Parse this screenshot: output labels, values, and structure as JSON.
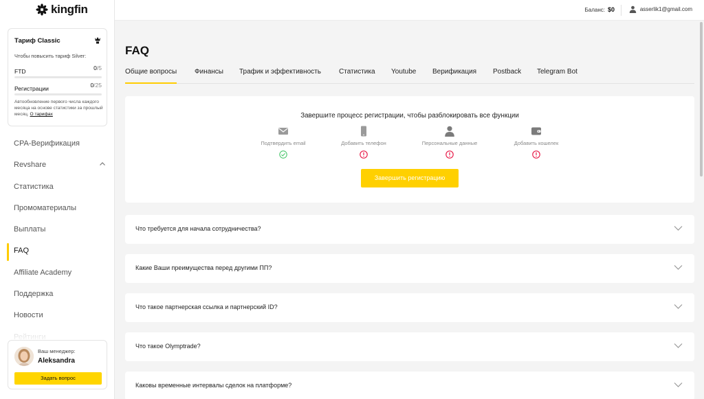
{
  "brand": {
    "name": "kingfin"
  },
  "tariff": {
    "title": "Тариф Classic",
    "subtitle": "Чтобы повысить тариф Silver:",
    "metrics": [
      {
        "label": "FTD",
        "current": "0",
        "total": "/5",
        "progress": 0
      },
      {
        "label": "Регистрации",
        "current": "0",
        "total": "/25",
        "progress": 0
      }
    ],
    "note": "Автообновление первого числа каждого месяца на основе статистики за прошлый месяц.",
    "note_link": "О тарифах"
  },
  "nav": {
    "items": [
      {
        "label": "CPA-Верификация"
      },
      {
        "label": "Revshare",
        "expanded": true
      },
      {
        "label": "Статистика"
      },
      {
        "label": "Промоматериалы"
      },
      {
        "label": "Выплаты"
      },
      {
        "label": "FAQ",
        "active": true
      },
      {
        "label": "Affiliate Academy"
      },
      {
        "label": "Поддержка"
      },
      {
        "label": "Новости"
      },
      {
        "label": "Рейтинги"
      }
    ]
  },
  "manager": {
    "label": "Ваш менеджер:",
    "name": "Aleksandra",
    "ask_button": "Задать вопрос"
  },
  "header": {
    "balance_label": "Баланс:",
    "balance_value": "$0",
    "user_email": "asserlik1@gmail.com"
  },
  "page": {
    "title": "FAQ",
    "tabs": [
      {
        "label": "Общие вопросы",
        "active": true
      },
      {
        "label": "Финансы"
      },
      {
        "label": "Трафик и эффективность"
      },
      {
        "label": "Статистика"
      },
      {
        "label": "Youtube"
      },
      {
        "label": "Верификация"
      },
      {
        "label": "Postback"
      },
      {
        "label": "Telegram Bot"
      }
    ]
  },
  "registration": {
    "title": "Завершите процесс регистрации, чтобы разблокировать все функции",
    "steps": [
      {
        "label": "Подтвердить email",
        "icon": "email-icon",
        "status": "done"
      },
      {
        "label": "Добавить телефон",
        "icon": "phone-icon",
        "status": "pending"
      },
      {
        "label": "Персональные данные",
        "icon": "person-icon",
        "status": "pending"
      },
      {
        "label": "Добавить кошелек",
        "icon": "wallet-icon",
        "status": "pending"
      }
    ],
    "button": "Завершить регистрацию"
  },
  "faq": {
    "items": [
      {
        "question": "Что требуется для начала сотрудничества?"
      },
      {
        "question": "Какие Ваши преимущества перед другими ПП?"
      },
      {
        "question": "Что такое партнерская ссылка и партнерский ID?"
      },
      {
        "question": "Что такое Olymptrade?"
      },
      {
        "question": "Каковы временные интервалы сделок на платформе?"
      }
    ]
  },
  "colors": {
    "accent": "#ffcc00",
    "success": "#3cc261",
    "warning": "#e8204c"
  }
}
